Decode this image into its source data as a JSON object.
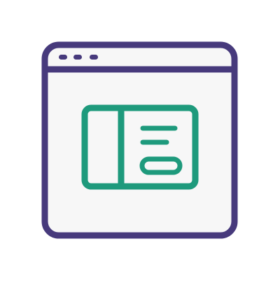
{
  "icon": {
    "name": "browser-window-layout-icon",
    "parts": {
      "window": "browser-window-icon",
      "dots": "window-control-dots-icon",
      "card": "layout-card-icon",
      "sidebar": "card-sidebar-panel-icon",
      "lines": "text-lines-icon",
      "button": "pill-button-icon"
    }
  },
  "colors": {
    "background": "#ffffff",
    "window_fill": "#f7f7f7",
    "window_stroke": "#473a7c",
    "accent": "#1e9a7c"
  }
}
